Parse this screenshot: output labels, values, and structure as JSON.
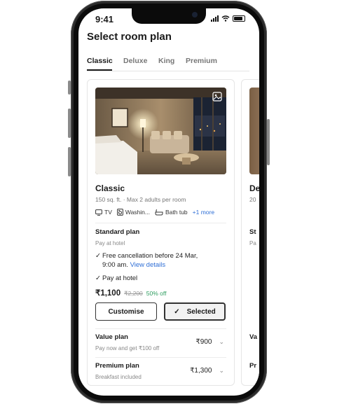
{
  "status_bar": {
    "time": "9:41"
  },
  "header": {
    "title": "Select room plan"
  },
  "tabs": [
    {
      "label": "Classic"
    },
    {
      "label": "Deluxe"
    },
    {
      "label": "King"
    },
    {
      "label": "Premium"
    }
  ],
  "room": {
    "name": "Classic",
    "details": "150 sq. ft. · Max 2 adults per room",
    "amenities": [
      {
        "label": "TV",
        "icon": "tv-icon"
      },
      {
        "label": "Washin...",
        "icon": "washing-machine-icon"
      },
      {
        "label": "Bath tub",
        "icon": "bathtub-icon"
      }
    ],
    "more_amenities": "+1 more",
    "photo_icon": "image-gallery-icon"
  },
  "standard_plan": {
    "title": "Standard plan",
    "subtitle": "Pay at hotel",
    "benefit_1": "Free cancellation before 24 Mar,",
    "benefit_1_cont": "9:00 am.",
    "view_details": "View details",
    "benefit_2": "Pay at hotel",
    "price": "₹1,100",
    "original_price": "₹2,200",
    "discount": "50% off",
    "customise_label": "Customise",
    "selected_label": "Selected"
  },
  "other_plans": [
    {
      "title": "Value plan",
      "subtitle": "Pay now and get ₹100 off",
      "price": "₹900"
    },
    {
      "title": "Premium plan",
      "subtitle": "Breakfast included",
      "price": "₹1,300"
    }
  ],
  "next_card": {
    "name": "De",
    "details": "20",
    "standard": "St",
    "sub": "Pa",
    "value": "Va",
    "premium": "Pr"
  },
  "colors": {
    "link": "#2f6fd6",
    "discount": "#2e9d5f"
  }
}
